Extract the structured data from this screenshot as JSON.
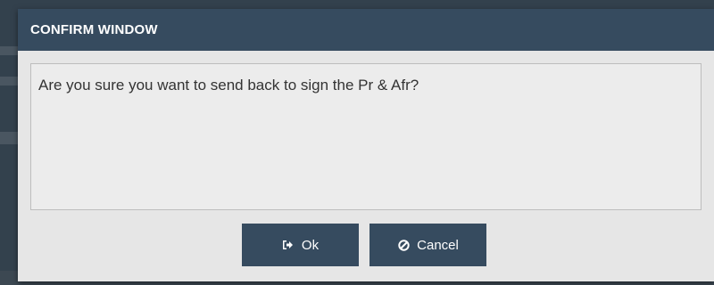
{
  "dialog": {
    "title": "CONFIRM WINDOW",
    "message": "Are you sure you want to send back to sign the Pr & Afr?",
    "ok_label": "Ok",
    "cancel_label": "Cancel",
    "ok_icon": "sign-out-icon",
    "cancel_icon": "ban-icon"
  },
  "colors": {
    "header_bg": "#364b5f",
    "button_bg": "#364b5f",
    "dialog_bg": "#e6e6e6",
    "text": "#333333"
  }
}
